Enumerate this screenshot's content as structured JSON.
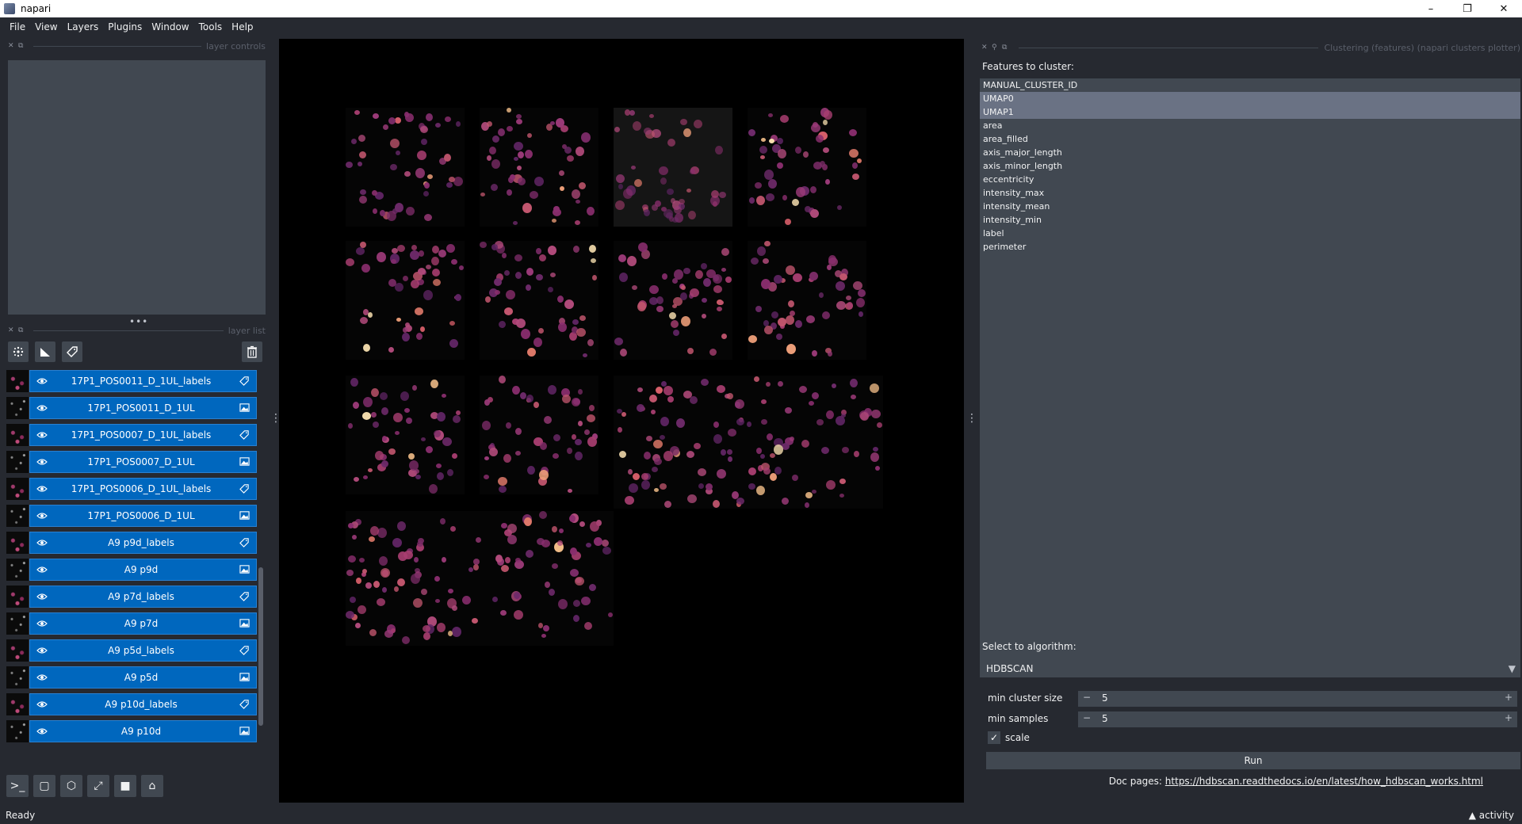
{
  "window": {
    "title": "napari",
    "controls": [
      "–",
      "❐",
      "✕"
    ]
  },
  "menu": [
    "File",
    "View",
    "Layers",
    "Plugins",
    "Window",
    "Tools",
    "Help"
  ],
  "layer_controls": {
    "title": "layer controls"
  },
  "layer_list": {
    "title": "layer list",
    "layers": [
      {
        "name": "17P1_POS0011_D_1UL_labels",
        "type": "labels"
      },
      {
        "name": "17P1_POS0011_D_1UL",
        "type": "image"
      },
      {
        "name": "17P1_POS0007_D_1UL_labels",
        "type": "labels"
      },
      {
        "name": "17P1_POS0007_D_1UL",
        "type": "image"
      },
      {
        "name": "17P1_POS0006_D_1UL_labels",
        "type": "labels"
      },
      {
        "name": "17P1_POS0006_D_1UL",
        "type": "image"
      },
      {
        "name": "A9 p9d_labels",
        "type": "labels"
      },
      {
        "name": "A9 p9d",
        "type": "image"
      },
      {
        "name": "A9 p7d_labels",
        "type": "labels"
      },
      {
        "name": "A9 p7d",
        "type": "image"
      },
      {
        "name": "A9 p5d_labels",
        "type": "labels"
      },
      {
        "name": "A9 p5d",
        "type": "image"
      },
      {
        "name": "A9 p10d_labels",
        "type": "labels"
      },
      {
        "name": "A9 p10d",
        "type": "image"
      }
    ]
  },
  "icons": {
    "points": "points-icon",
    "shapes": "shapes-icon",
    "labels": "labels-icon",
    "delete": "trash-icon",
    "console": "console-icon",
    "ndisplay": "square-icon",
    "roll": "cube-icon",
    "transpose": "transpose-icon",
    "grid": "grid-icon",
    "home": "home-icon"
  },
  "plugin": {
    "title": "Clustering (features) (napari clusters plotter)",
    "features_label": "Features to cluster:",
    "features": [
      {
        "name": "MANUAL_CLUSTER_ID",
        "selected": false
      },
      {
        "name": "UMAP0",
        "selected": true
      },
      {
        "name": "UMAP1",
        "selected": true
      },
      {
        "name": "area",
        "selected": false
      },
      {
        "name": "area_filled",
        "selected": false
      },
      {
        "name": "axis_major_length",
        "selected": false
      },
      {
        "name": "axis_minor_length",
        "selected": false
      },
      {
        "name": "eccentricity",
        "selected": false
      },
      {
        "name": "intensity_max",
        "selected": false
      },
      {
        "name": "intensity_mean",
        "selected": false
      },
      {
        "name": "intensity_min",
        "selected": false
      },
      {
        "name": "label",
        "selected": false
      },
      {
        "name": "perimeter",
        "selected": false
      }
    ],
    "algo_label": "Select to algorithm:",
    "algorithm": "HDBSCAN",
    "params": [
      {
        "label": "min cluster size",
        "value": "5"
      },
      {
        "label": "min samples",
        "value": "5"
      }
    ],
    "scale_label": "scale",
    "scale_checked": true,
    "run_label": "Run",
    "doc_prefix": "Doc pages:",
    "doc_link": "https://hdbscan.readthedocs.io/en/latest/how_hdbscan_works.html"
  },
  "status": {
    "text": "Ready",
    "activity": "activity"
  }
}
